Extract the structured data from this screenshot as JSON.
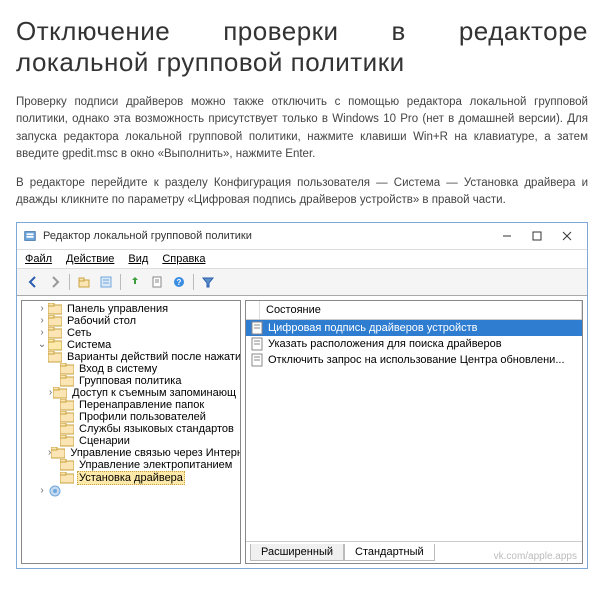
{
  "article": {
    "heading": "Отключение проверки в редакторе локальной групповой политики",
    "p1": "Проверку подписи драйверов можно также отключить с помощью редактора локальной групповой политики, однако эта возможность присутствует только в Windows 10 Pro (нет в домашней версии). Для запуска редактора локальной групповой политики, нажмите клавиши Win+R на клавиатуре, а затем введите gpedit.msc в окно «Выполнить», нажмите Enter.",
    "p2": "В редакторе перейдите к разделу Конфигурация пользователя — Система — Установка драйвера и дважды кликните по параметру «Цифровая подпись драйверов устройств» в правой части."
  },
  "window": {
    "title": "Редактор локальной групповой политики",
    "menu": {
      "file": "Файл",
      "action": "Действие",
      "view": "Вид",
      "help": "Справка"
    },
    "list": {
      "col_blank": "",
      "col_state": "Состояние",
      "items": [
        "Цифровая подпись драйверов устройств",
        "Указать расположения для поиска драйверов",
        "Отключить запрос на использование Центра обновлени..."
      ]
    },
    "tree": {
      "n0": "Панель управления",
      "n1": "Рабочий стол",
      "n2": "Сеть",
      "n3": "Система",
      "n3_0": "Варианты действий после нажати",
      "n3_1": "Вход в систему",
      "n3_2": "Групповая политика",
      "n3_3": "Доступ к съемным запоминающ",
      "n3_4": "Перенаправление папок",
      "n3_5": "Профили пользователей",
      "n3_6": "Службы языковых стандартов",
      "n3_7": "Сценарии",
      "n3_8": "Управление связью через Интернe",
      "n3_9": "Управление электропитанием",
      "n3_10": "Установка драйвера"
    },
    "tabs": {
      "ext": "Расширенный",
      "std": "Стандартный"
    }
  },
  "watermark": "vk.com/apple.apps"
}
